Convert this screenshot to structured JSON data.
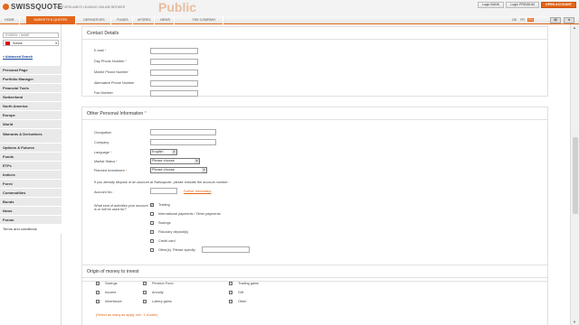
{
  "header": {
    "logo": "SWISSQUOTE",
    "tagline": "SWITZERLAND'S LEADING ONLINE BROKER",
    "banner": "Public",
    "login_bank": "Login BANK",
    "login_premium": "Login PREMIUM",
    "open_account": "OPEN ACCOUNT"
  },
  "nav": {
    "tabs": [
      "HOME",
      "MARKETS & QUOTES",
      "DERIVATIVES",
      "FUNDS",
      "eFOREX",
      "NEWS",
      "THE COMPANY"
    ],
    "langs": [
      "DE",
      "FR",
      "EN"
    ]
  },
  "sidebar": {
    "search_placeholder": "SYMBOL / NAME",
    "market": "Suisse",
    "advanced_search": "Advanced Search",
    "menu": [
      "Personal Page",
      "Portfolio Manager",
      "Financial Tools",
      "Switzerland",
      "North America",
      "Europe",
      "World",
      "Warrants & Derivatives",
      "Options & Futures",
      "Funds",
      "ETFs",
      "Indices",
      "Forex",
      "Commodities",
      "Bonds",
      "News",
      "Forum"
    ],
    "terms": "Terms and conditions"
  },
  "contact": {
    "title": "Contact Details",
    "fields": [
      "E-mail",
      "Day Phone Number",
      "Mobile Phone Number",
      "Alternative Phone Number",
      "Fax Number"
    ]
  },
  "personal": {
    "title": "Other Personal Information",
    "occupation": "Occupation",
    "company": "Company",
    "language": "Language",
    "language_value": "English",
    "marital": "Marital Status",
    "marital_value": "Please choose",
    "planned": "Planned Investment",
    "planned_value": "Please choose",
    "account_note": "If you already dispose of an account at Swissquote, please indicate the account number:",
    "account_no": "Account No",
    "further_info": "Further Information",
    "activities_q": "What kind of activities your account is or will be used for?",
    "activities": [
      "Trading",
      "International payments / Other payments",
      "Savings",
      "Fiduciary deposit(s)",
      "Credit card",
      "Other(s). Please specify:"
    ]
  },
  "origin": {
    "title": "Origin of money to invest",
    "col1": [
      "Savings",
      "Income",
      "Inheritance"
    ],
    "col2": [
      "Pension Fund",
      "Annuity",
      "Lottery gains"
    ],
    "col3": [
      "Trading gains",
      "Gift",
      "Other"
    ],
    "note": "(Select as many as apply, min. 1 choice)"
  }
}
